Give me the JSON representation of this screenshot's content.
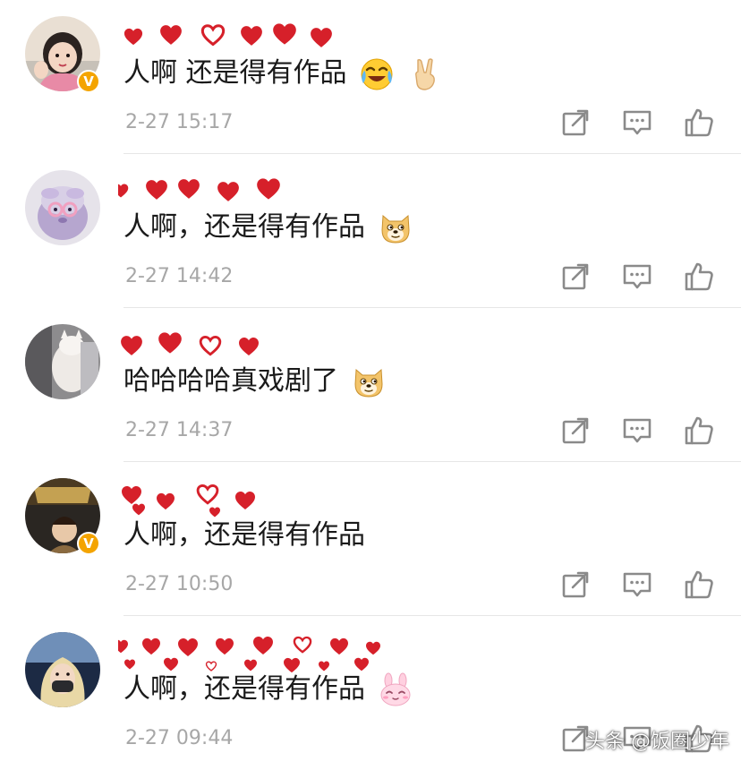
{
  "comments": [
    {
      "text": "人啊 还是得有作品",
      "emojis": [
        "laughing-crying-face",
        "victory-hand"
      ],
      "time": "2-27 15:17",
      "verified": true,
      "avatar": "girl-photo"
    },
    {
      "text": "人啊，还是得有作品",
      "emojis": [
        "doge-face"
      ],
      "time": "2-27 14:42",
      "verified": false,
      "avatar": "plush-sheep-toy"
    },
    {
      "text": "哈哈哈哈真戏剧了",
      "emojis": [
        "doge-face"
      ],
      "time": "2-27 14:37",
      "verified": false,
      "avatar": "white-cat"
    },
    {
      "text": "人啊，还是得有作品",
      "emojis": [],
      "time": "2-27 10:50",
      "verified": true,
      "avatar": "movie-poster"
    },
    {
      "text": "人啊，还是得有作品",
      "emojis": [
        "pink-bunny-face"
      ],
      "time": "2-27 09:44",
      "verified": false,
      "avatar": "woman-with-mask"
    }
  ],
  "actions": [
    "share-icon",
    "reply-icon",
    "like-icon"
  ],
  "verified_badge": "V",
  "watermark": "头条 @饭圈少年",
  "colors": {
    "heart_red": "#d6202a",
    "timestamp_gray": "#a7a7a7",
    "icon_gray": "#8a8a8a",
    "divider": "#e6e6e6",
    "verified_badge": "#f4a400"
  }
}
